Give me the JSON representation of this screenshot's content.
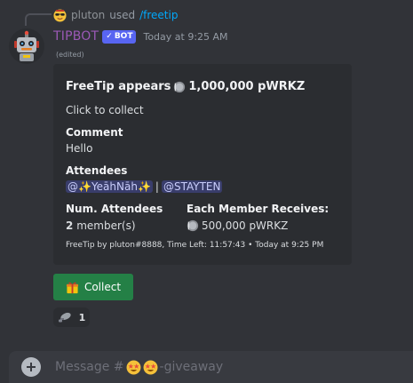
{
  "command": {
    "user": "pluton",
    "used": "used",
    "command": "/freetip"
  },
  "message": {
    "bot_name": "TIPBOT",
    "badge_check": "✓",
    "badge": "BOT",
    "timestamp": "Today at 9:25 AM",
    "edited": "(edited)"
  },
  "embed": {
    "title_prefix": "FreeTip appears",
    "title_amount": "1,000,000 pWRKZ",
    "description": "Click to collect",
    "comment_label": "Comment",
    "comment_value": "Hello",
    "attendees_label": "Attendees",
    "attendees": [
      "@✨YeāhNāh✨",
      "@STAYTEN"
    ],
    "attendees_separator": "|",
    "num_attendees_label": "Num. Attendees",
    "num_attendees_count": "2",
    "num_attendees_unit": "member(s)",
    "each_receives_label": "Each Member Receives:",
    "each_receives_value": "500,000 pWRKZ",
    "footer": "FreeTip  by pluton#8888, Time Left: 11:57:43 • Today at 9:25 PM"
  },
  "collect_button": {
    "icon": "🎁",
    "label": "Collect"
  },
  "reaction": {
    "count": "1"
  },
  "composer": {
    "placeholder_prefix": "Message #",
    "placeholder_suffix": "-giveaway"
  },
  "colors": {
    "background": "#313338",
    "embed_bg": "#2b2d31",
    "bot_name": "#9b59b6",
    "badge": "#5865f2",
    "link": "#00a8fc",
    "collect_button": "#248046",
    "composer_bg": "#383a40"
  },
  "icons": {
    "command_avatar": "smiling-face-with-sunglasses-icon",
    "bot_avatar": "robot-avatar-icon",
    "coin": "coin-icon",
    "gift": "gift-icon",
    "reaction": "satellite-dish-icon",
    "plus": "plus-circle-icon",
    "channel_emoji": "star-struck-icon"
  }
}
